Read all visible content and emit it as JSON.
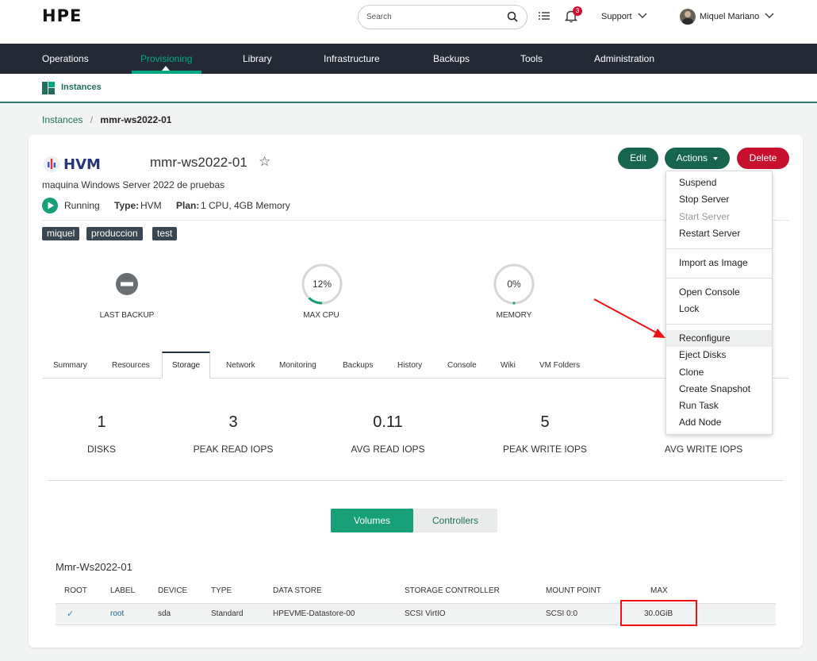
{
  "header": {
    "logo": "HPE",
    "search_placeholder": "Search",
    "notification_count": "3",
    "support_label": "Support",
    "user_name": "Miquel Mariano"
  },
  "nav": {
    "items": [
      "Operations",
      "Provisioning",
      "Library",
      "Infrastructure",
      "Backups",
      "Tools",
      "Administration"
    ],
    "active": "Provisioning"
  },
  "subnav": {
    "label": "Instances"
  },
  "breadcrumb": {
    "parent": "Instances",
    "separator": "/",
    "current": "mmr-ws2022-01"
  },
  "instance": {
    "cloud_logo_text": "HVM",
    "name": "mmr-ws2022-01",
    "description": "maquina Windows Server 2022 de pruebas",
    "status": "Running",
    "type_label": "Type:",
    "type_value": "HVM",
    "plan_label": "Plan:",
    "plan_value": "1 CPU, 4GB Memory",
    "tags": [
      "miquel",
      "produccion",
      "test"
    ]
  },
  "gauges": {
    "last_backup_label": "LAST BACKUP",
    "cpu_value": "12%",
    "cpu_fraction": 0.12,
    "cpu_label": "MAX CPU",
    "memory_value": "0%",
    "memory_fraction": 0.0,
    "memory_label": "MEMORY"
  },
  "buttons": {
    "edit": "Edit",
    "actions": "Actions",
    "delete": "Delete"
  },
  "actions_menu": {
    "group1": [
      "Suspend",
      "Stop Server",
      "Start Server",
      "Restart Server"
    ],
    "disabled": "Start Server",
    "group2": [
      "Import as Image"
    ],
    "group3": [
      "Open Console",
      "Lock"
    ],
    "group4": [
      "Reconfigure",
      "Eject Disks",
      "Clone",
      "Create Snapshot",
      "Run Task",
      "Add Node"
    ],
    "highlighted": "Reconfigure"
  },
  "tabs": [
    "Summary",
    "Resources",
    "Storage",
    "Network",
    "Monitoring",
    "Backups",
    "History",
    "Console",
    "Wiki",
    "VM Folders"
  ],
  "active_tab": "Storage",
  "storage_stats": [
    {
      "value": "1",
      "label": "DISKS"
    },
    {
      "value": "3",
      "label": "PEAK READ IOPS"
    },
    {
      "value": "0.11",
      "label": "AVG READ IOPS"
    },
    {
      "value": "5",
      "label": "PEAK WRITE IOPS"
    },
    {
      "value": "",
      "label": "AVG WRITE IOPS"
    }
  ],
  "storage_toggle": {
    "volumes": "Volumes",
    "controllers": "Controllers",
    "active": "Volumes"
  },
  "volumes": {
    "group_title": "Mmr-Ws2022-01",
    "columns": [
      "ROOT",
      "LABEL",
      "DEVICE",
      "TYPE",
      "DATA STORE",
      "STORAGE CONTROLLER",
      "MOUNT POINT",
      "MAX"
    ],
    "rows": [
      {
        "root": "✓",
        "label": "root",
        "device": "sda",
        "type": "Standard",
        "datastore": "HPEVME-Datastore-00",
        "controller": "SCSI VirtIO",
        "mount": "SCSI 0:0",
        "max": "30.0GiB"
      }
    ]
  },
  "colors": {
    "brand_green": "#01a982",
    "nav_bg": "#232a36",
    "delete_red": "#c8102e",
    "edit_green": "#17644f",
    "annotation_red": "#ee1111"
  }
}
